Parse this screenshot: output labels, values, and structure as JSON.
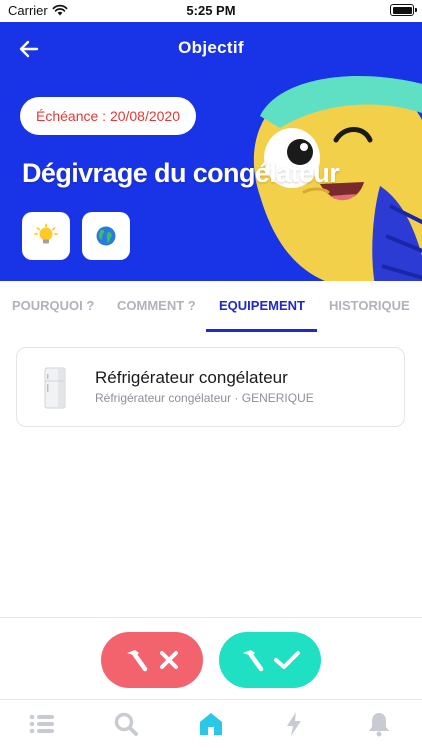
{
  "status_bar": {
    "carrier": "Carrier",
    "time": "5:25 PM"
  },
  "header": {
    "title": "Objectif"
  },
  "goal": {
    "deadline": "Échéance : 20/08/2020",
    "title": "Dégivrage du congélateur",
    "badges": [
      "lightbulb-icon",
      "earth-icon"
    ]
  },
  "tabs": [
    {
      "label": "POURQUOI ?",
      "active": false
    },
    {
      "label": "COMMENT ?",
      "active": false
    },
    {
      "label": "EQUIPEMENT",
      "active": true
    },
    {
      "label": "HISTORIQUE",
      "active": false
    }
  ],
  "equipment": {
    "name": "Réfrigérateur congélateur",
    "detail": "Réfrigérateur congélateur · GENERIQUE"
  },
  "actions": {
    "reject_icons": [
      "hammer-icon",
      "cross-icon"
    ],
    "accept_icons": [
      "hammer-icon",
      "check-icon"
    ]
  },
  "bottom_nav": [
    "list-icon",
    "search-icon",
    "home-icon",
    "bolt-icon",
    "bell-icon"
  ],
  "colors": {
    "brand_blue": "#1934e6",
    "tab_active": "#1c2ad0",
    "tab_inactive": "#b0b3bb",
    "deadline_red": "#e53935",
    "reject_red": "#f2636d",
    "accept_teal": "#1fe0c2",
    "nav_active": "#2bc7e6",
    "nav_inactive": "#c8cbd1"
  }
}
